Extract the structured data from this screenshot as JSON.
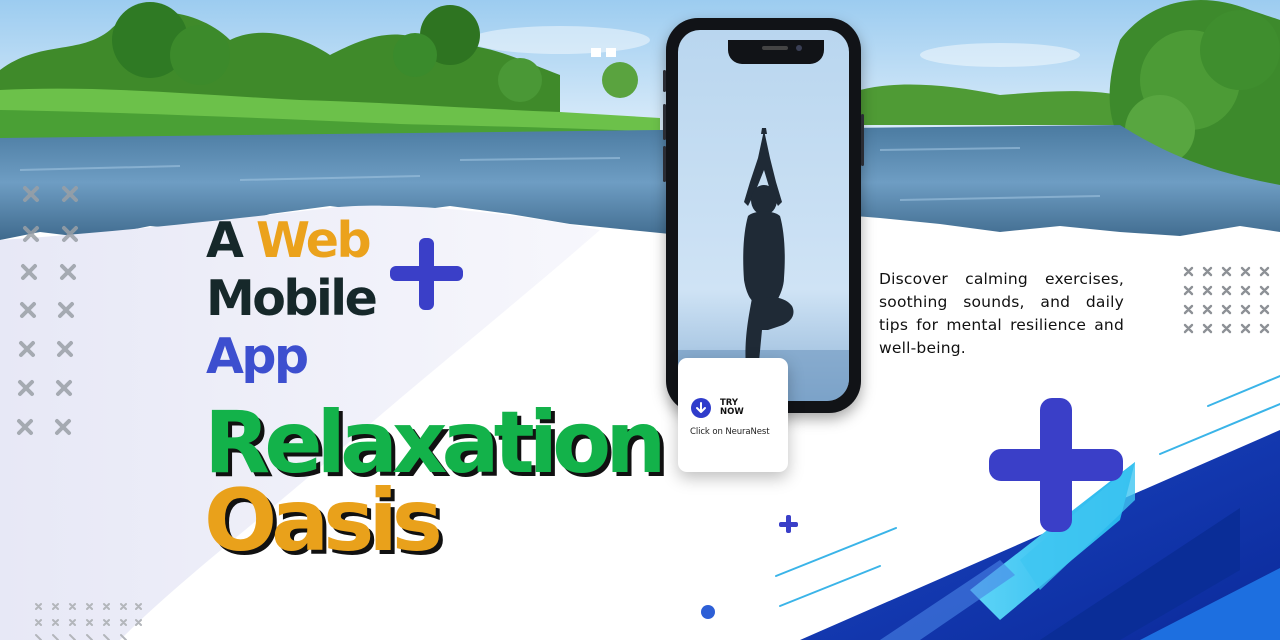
{
  "hero": {
    "line1_word1": "A",
    "line1_word2": "Web",
    "line2": "Mobile",
    "line3": "App",
    "title_line1": "Relaxation",
    "title_line2": "Oasis"
  },
  "description": "Discover calming exercises, soothing sounds, and daily tips for mental resilience and well-being.",
  "cta": {
    "label": "TRY\nNOW",
    "subtext": "Click on NeuraNest"
  },
  "colors": {
    "headline_dark": "#16282a",
    "accent_orange": "#eba21c",
    "accent_blue": "#3d4fcf",
    "title_green": "#13b24a",
    "plus_blue": "#3a3fc8",
    "stripe_navy": "#0f3ab3",
    "stripe_cyan": "#2fc7f2"
  },
  "icons": {
    "download": "download-icon",
    "plus": "plus-icon",
    "cross": "cross-pattern-icon"
  }
}
